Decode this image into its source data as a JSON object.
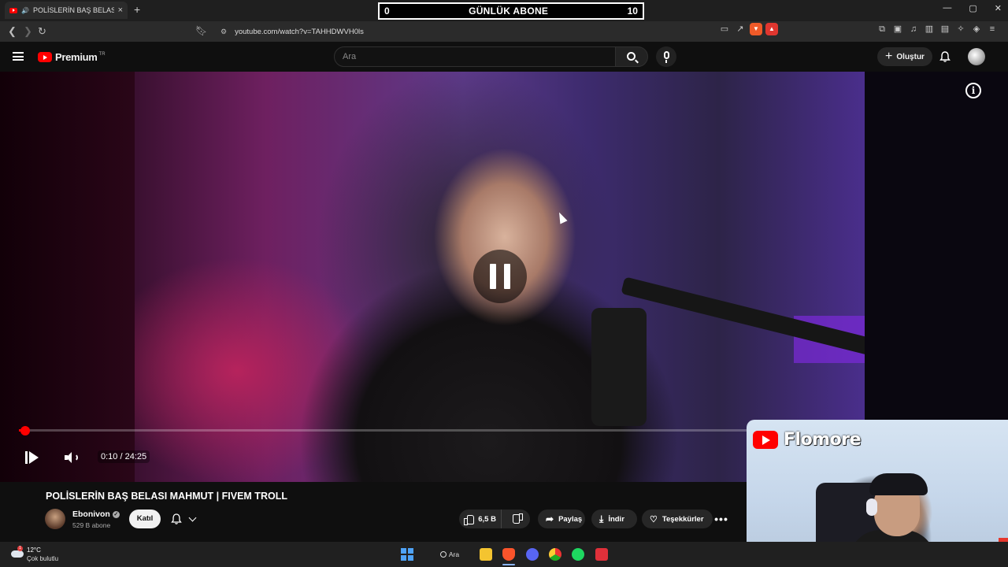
{
  "browser": {
    "tab_title": "POLİSLERİN BAŞ BELASI MAHMUT",
    "tab_close": "×",
    "new_tab": "+",
    "url": "youtube.com/watch?v=TAHHDWVH0ls",
    "window_controls": [
      "—",
      "▢",
      "✕"
    ]
  },
  "sub_counter": {
    "left_value": "0",
    "label": "GÜNLÜK ABONE",
    "right_value": "10"
  },
  "youtube_header": {
    "logo_text": "Premium",
    "region_code": "TR",
    "search_placeholder": "Ara",
    "create_label": "Oluştur"
  },
  "player": {
    "state": "paused",
    "current_time": "0:10",
    "duration": "24:25",
    "time_display": "0:10 / 24:25",
    "progress_fraction": 0.0068
  },
  "video": {
    "title": "POLİSLERİN BAŞ BELASI MAHMUT | FIVEM TROLL",
    "channel_name": "Ebonivon",
    "verified_mark": "✓",
    "subscriber_count": "529 B abone",
    "join_label": "Katıl",
    "like_count": "6,5 B",
    "share_label": "Paylaş",
    "download_label": "İndir",
    "thanks_label": "Teşekkürler",
    "more_label": "•••"
  },
  "webcam": {
    "brand_name": "Flomore"
  },
  "taskbar": {
    "weather_temp": "12°C",
    "weather_desc": "Çok bulutlu",
    "weather_badge": "1",
    "search_label": "Ara"
  },
  "colors": {
    "youtube_red": "#ff0000",
    "page_bg": "#0f0f0f",
    "pill_bg": "#272727"
  }
}
